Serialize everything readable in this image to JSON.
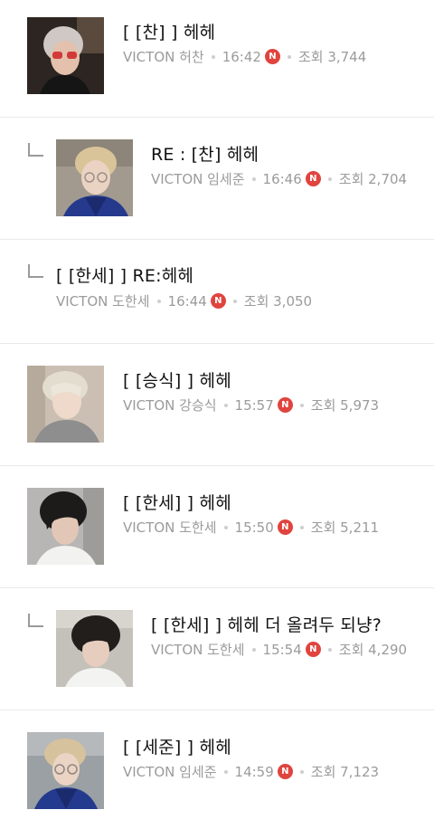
{
  "colors": {
    "new_badge": "#e0443e",
    "meta_text": "#9b9b9b",
    "divider": "#e9e9e9"
  },
  "posts": [
    {
      "title": "[ [찬] ] 헤헤",
      "author": "VICTON 허찬",
      "time": "16:42",
      "new_badge": "N",
      "views": "조회 3,744",
      "is_reply": false,
      "photo": "chan-photo"
    },
    {
      "title": "RE : [찬] 헤헤",
      "author": "VICTON 임세준",
      "time": "16:46",
      "new_badge": "N",
      "views": "조회 2,704",
      "is_reply": true,
      "photo": "sejun-photo"
    },
    {
      "title": "[ [한세] ] RE:헤헤",
      "author": "VICTON 도한세",
      "time": "16:44",
      "new_badge": "N",
      "views": "조회 3,050",
      "is_reply": true,
      "photo": null
    },
    {
      "title": "[ [승식] ] 헤헤",
      "author": "VICTON 강승식",
      "time": "15:57",
      "new_badge": "N",
      "views": "조회 5,973",
      "is_reply": false,
      "photo": "seungsik-photo"
    },
    {
      "title": "[ [한세] ] 헤헤",
      "author": "VICTON 도한세",
      "time": "15:50",
      "new_badge": "N",
      "views": "조회 5,211",
      "is_reply": false,
      "photo": "hanse-photo"
    },
    {
      "title": "[ [한세] ] 헤헤 더 올려두 되냥?",
      "author": "VICTON 도한세",
      "time": "15:54",
      "new_badge": "N",
      "views": "조회 4,290",
      "is_reply": true,
      "photo": "hanse-photo-2"
    },
    {
      "title": "[ [세준] ] 헤헤",
      "author": "VICTON 임세준",
      "time": "14:59",
      "new_badge": "N",
      "views": "조회 7,123",
      "is_reply": false,
      "photo": "sejun-photo-2"
    }
  ]
}
